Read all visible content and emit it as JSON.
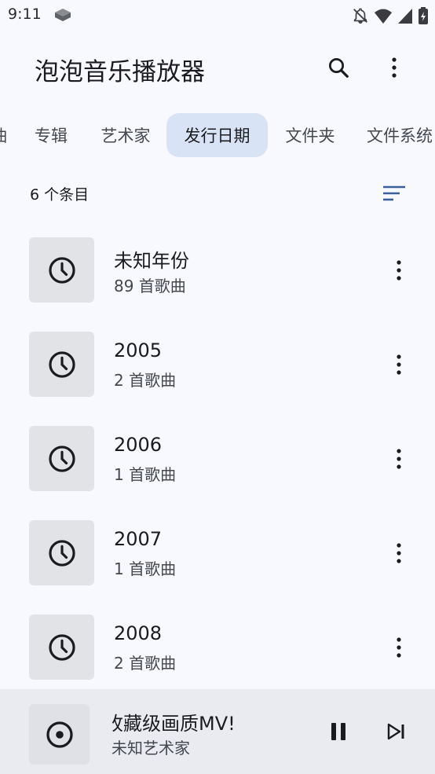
{
  "status_bar": {
    "time": "9:11",
    "icons": [
      "app-notification-icon",
      "notifications-off-icon",
      "wifi-icon",
      "signal-icon",
      "battery-icon"
    ]
  },
  "app_bar": {
    "title": "泡泡音乐播放器",
    "actions": [
      "search-icon",
      "more-vert-icon"
    ]
  },
  "tabs": [
    {
      "label": "曲",
      "active": false
    },
    {
      "label": "专辑",
      "active": false
    },
    {
      "label": "艺术家",
      "active": false
    },
    {
      "label": "发行日期",
      "active": true
    },
    {
      "label": "文件夹",
      "active": false
    },
    {
      "label": "文件系统",
      "active": false
    }
  ],
  "list_header": {
    "count_label": "6 个条目",
    "sort_icon": "sort-icon"
  },
  "items": [
    {
      "title": "未知年份",
      "subtitle": "89 首歌曲",
      "icon": "clock-icon"
    },
    {
      "title": "2005",
      "subtitle": "2 首歌曲",
      "icon": "clock-icon"
    },
    {
      "title": "2006",
      "subtitle": "1 首歌曲",
      "icon": "clock-icon"
    },
    {
      "title": "2007",
      "subtitle": "1 首歌曲",
      "icon": "clock-icon"
    },
    {
      "title": "2008",
      "subtitle": "2 首歌曲",
      "icon": "clock-icon"
    }
  ],
  "now_playing": {
    "title": "收藏级画质MV!",
    "artist": "未知艺术家",
    "controls": [
      "pause-icon",
      "skip-next-icon"
    ]
  },
  "colors": {
    "background": "#f8f9fe",
    "active_tab": "#d8e3f6",
    "accent": "#3a5f99",
    "thumb_bg": "#e2e3e7",
    "player_bg": "#e9ebf1"
  }
}
